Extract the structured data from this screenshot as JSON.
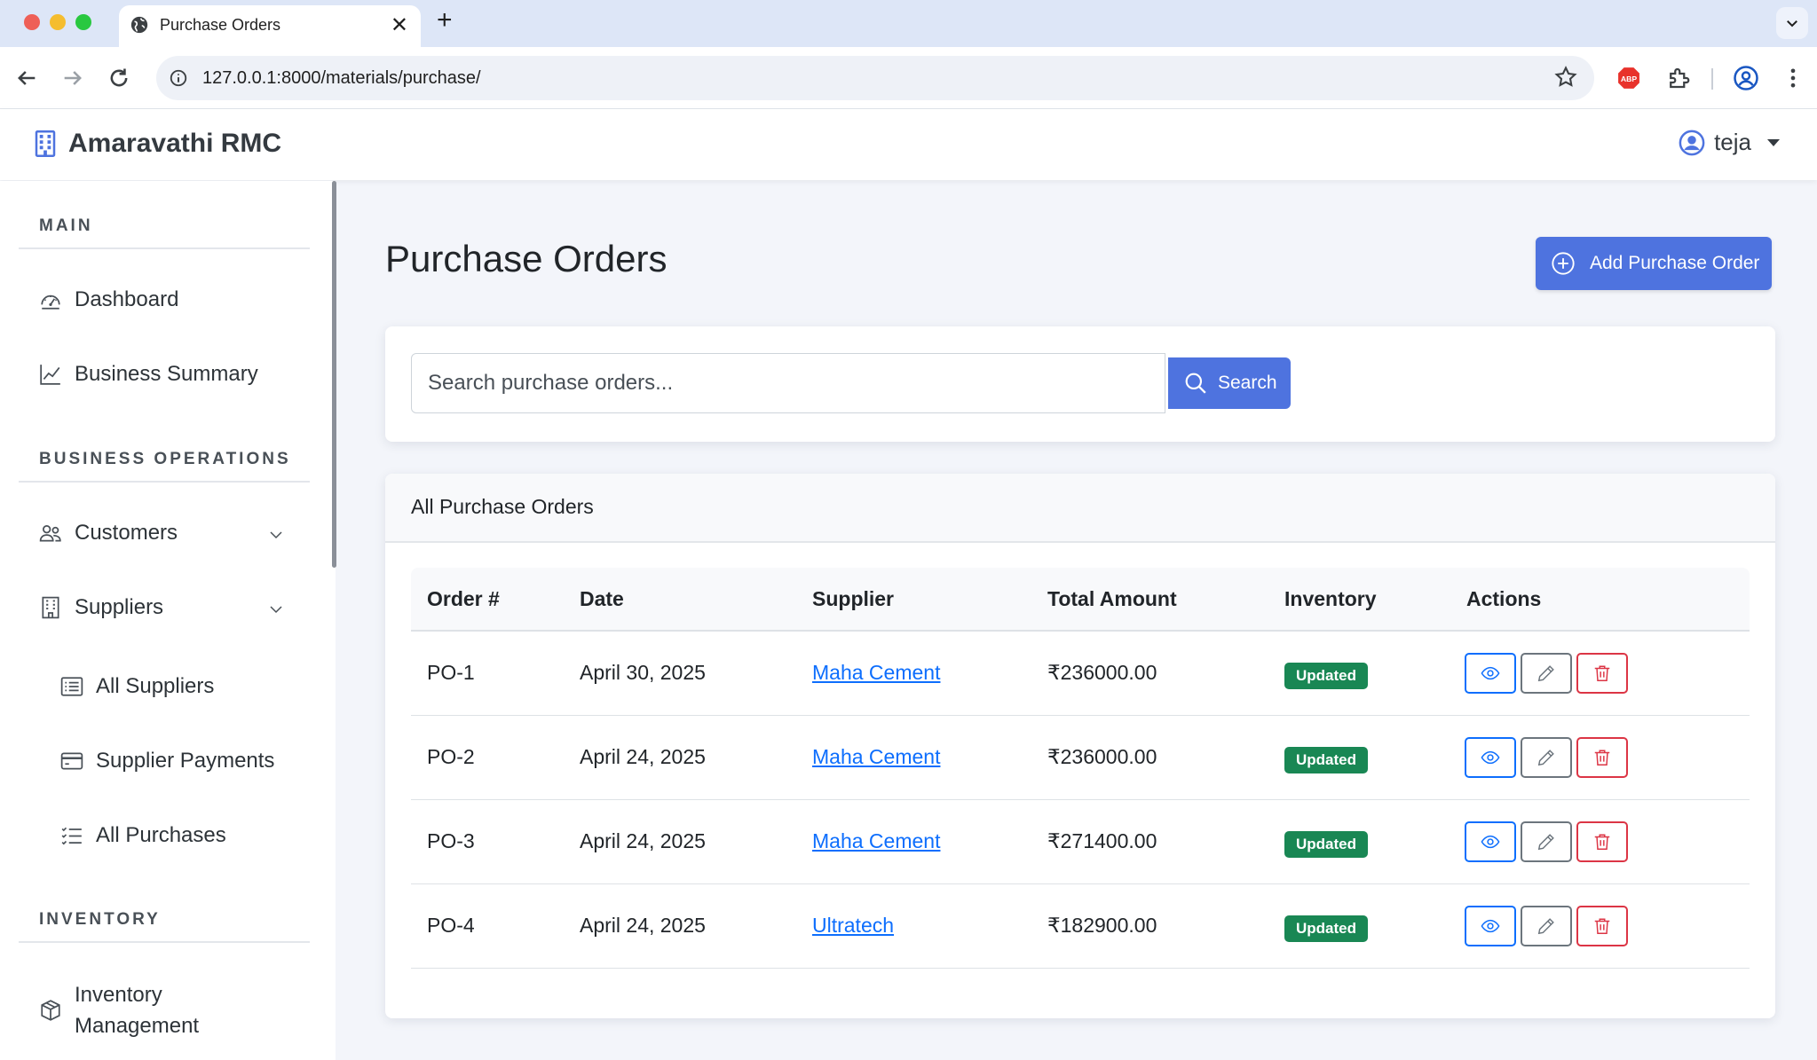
{
  "browser": {
    "tab_title": "Purchase Orders",
    "url": "127.0.0.1:8000/materials/purchase/",
    "new_tab_glyph": "+",
    "close_glyph": "✕"
  },
  "app": {
    "brand": "Amaravathi RMC",
    "user_name": "teja"
  },
  "sidebar": {
    "sections": [
      {
        "title": "MAIN"
      },
      {
        "title": "BUSINESS OPERATIONS"
      },
      {
        "title": "INVENTORY"
      }
    ],
    "items": [
      {
        "label": "Dashboard",
        "icon": "speedometer-icon"
      },
      {
        "label": "Business Summary",
        "icon": "graph-up-icon"
      },
      {
        "label": "Customers",
        "icon": "people-icon",
        "expandable": true
      },
      {
        "label": "Suppliers",
        "icon": "building-icon",
        "expandable": true
      },
      {
        "label": "All Suppliers",
        "icon": "list-icon"
      },
      {
        "label": "Supplier Payments",
        "icon": "credit-card-icon"
      },
      {
        "label": "All Purchases",
        "icon": "list-check-icon"
      },
      {
        "label_line1": "Inventory",
        "label_line2": "Management",
        "icon": "box-icon"
      }
    ]
  },
  "main": {
    "title": "Purchase Orders",
    "add_button": "Add Purchase Order",
    "search": {
      "placeholder": "Search purchase orders...",
      "button": "Search"
    },
    "table": {
      "card_title": "All Purchase Orders",
      "columns": [
        "Order #",
        "Date",
        "Supplier",
        "Total Amount",
        "Inventory",
        "Actions"
      ],
      "rows": [
        {
          "order": "PO-1",
          "date": "April 30, 2025",
          "supplier": "Maha Cement",
          "total": "₹236000.00",
          "inventory": "Updated"
        },
        {
          "order": "PO-2",
          "date": "April 24, 2025",
          "supplier": "Maha Cement",
          "total": "₹236000.00",
          "inventory": "Updated"
        },
        {
          "order": "PO-3",
          "date": "April 24, 2025",
          "supplier": "Maha Cement",
          "total": "₹271400.00",
          "inventory": "Updated"
        },
        {
          "order": "PO-4",
          "date": "April 24, 2025",
          "supplier": "Ultratech",
          "total": "₹182900.00",
          "inventory": "Updated"
        }
      ]
    }
  },
  "colors": {
    "primary": "#4e73df",
    "success": "#198754",
    "danger": "#dc3545",
    "link": "#0d6efd",
    "page_bg": "#f3f5fa"
  }
}
